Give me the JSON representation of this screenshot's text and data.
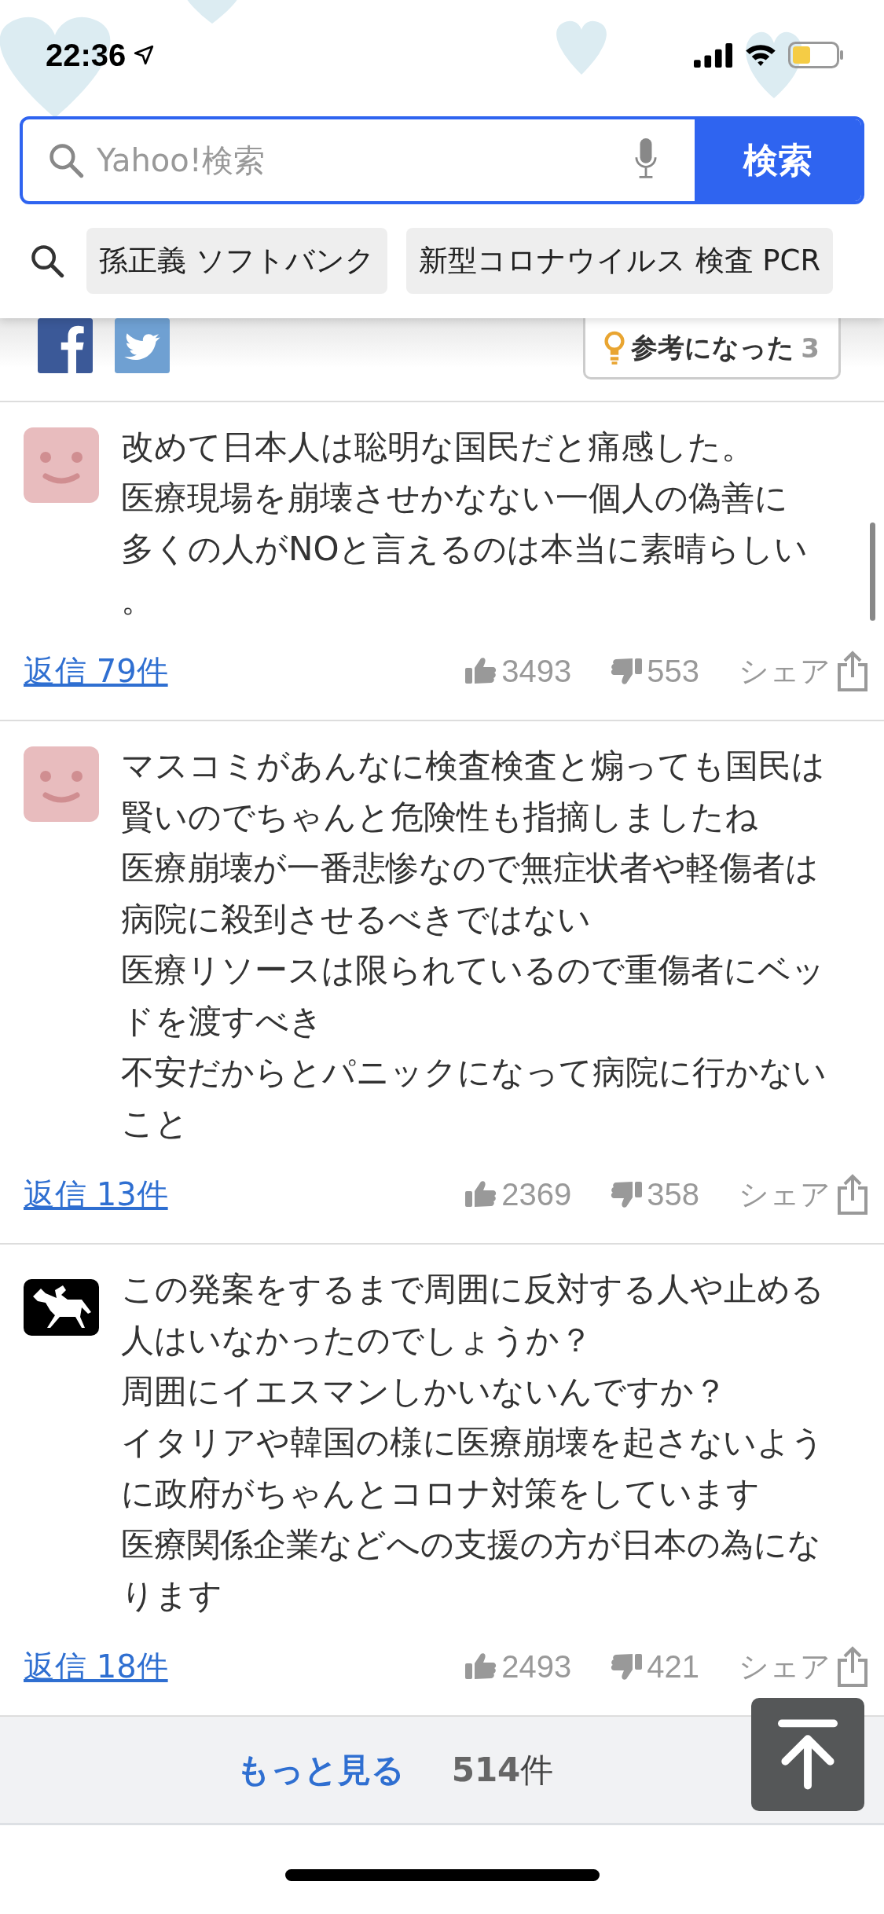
{
  "status_bar": {
    "time": "22:36"
  },
  "search": {
    "placeholder": "Yahoo!検索",
    "button": "検索"
  },
  "suggestions": [
    "孫正義 ソフトバンク",
    "新型コロナウイルス 検査 PCR"
  ],
  "share_row": {
    "helpful_label": "参考になった",
    "helpful_count": "3"
  },
  "comments": [
    {
      "kind": "smile",
      "lines": [
        "改めて日本人は聡明な国民だと痛感した。",
        "医療現場を崩壊させかなない一個人の偽善に",
        "多くの人がNOと言えるのは本当に素晴らしい",
        "。"
      ],
      "replies": "返信 79件",
      "likes": "3493",
      "dislikes": "553",
      "share": "シェア"
    },
    {
      "kind": "smile",
      "lines": [
        "マスコミがあんなに検査検査と煽っても国民は",
        "賢いのでちゃんと危険性も指摘しましたね",
        "医療崩壊が一番悲惨なので無症状者や軽傷者は",
        "病院に殺到させるべきではない",
        "医療リソースは限られているので重傷者にベッ",
        "ドを渡すべき",
        "不安だからとパニックになって病院に行かない",
        "こと"
      ],
      "replies": "返信 13件",
      "likes": "2369",
      "dislikes": "358",
      "share": "シェア"
    },
    {
      "kind": "horse",
      "lines": [
        "この発案をするまで周囲に反対する人や止める",
        "人はいなかったのでしょうか？",
        "周囲にイエスマンしかいないんですか？",
        "イタリアや韓国の様に医療崩壊を起さないよう",
        "に政府がちゃんとコロナ対策をしています",
        "医療関係企業などへの支援の方が日本の為にな",
        "ります"
      ],
      "replies": "返信 18件",
      "likes": "2493",
      "dislikes": "421",
      "share": "シェア"
    }
  ],
  "more": {
    "label": "もっと見る",
    "count": "**514**件"
  }
}
